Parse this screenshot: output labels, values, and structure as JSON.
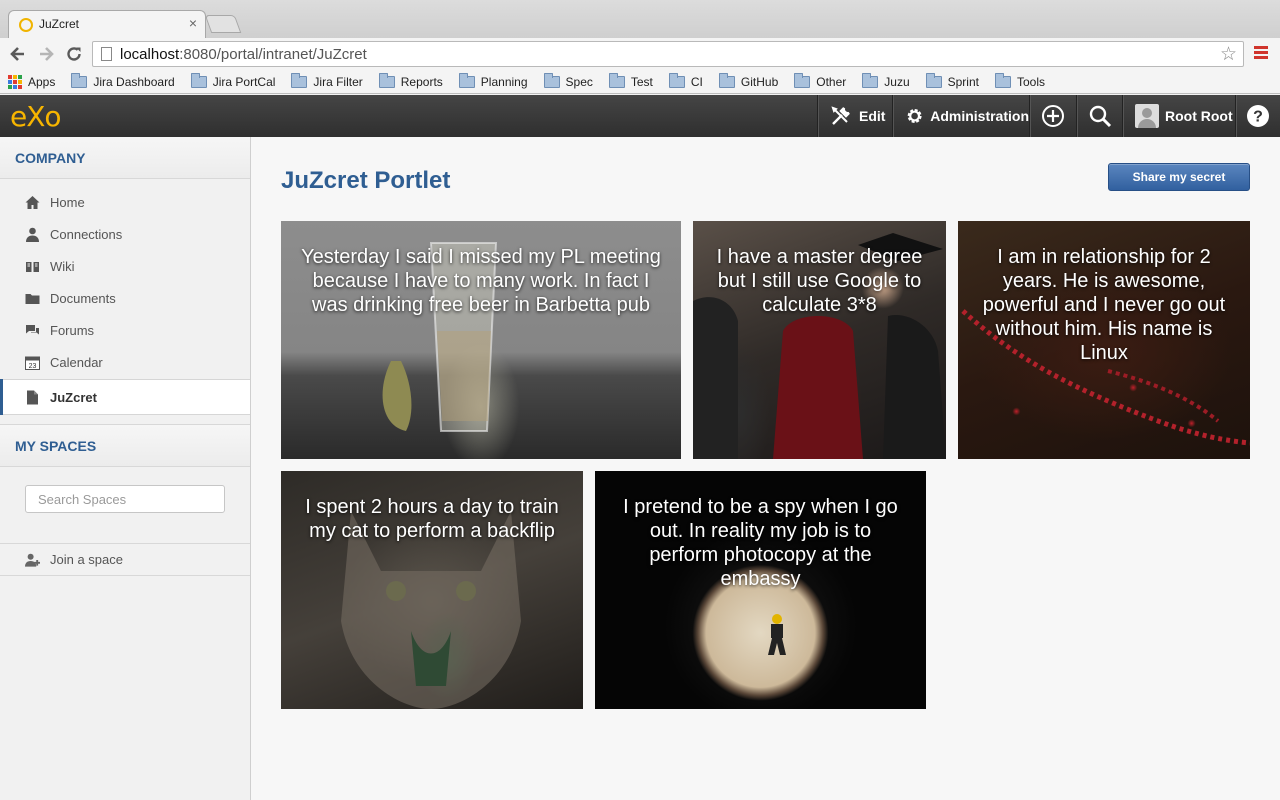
{
  "browser": {
    "tab_title": "JuZcret",
    "tab_close": "×",
    "url_host": "localhost",
    "url_rest": ":8080/portal/intranet/JuZcret",
    "back_icon": "arrow-left-icon",
    "forward_icon": "arrow-right-icon",
    "reload_icon": "reload-icon",
    "star_glyph": "☆",
    "bookmarks": [
      {
        "label": "Apps",
        "icon": "apps-grid-icon"
      },
      {
        "label": "Jira Dashboard",
        "icon": "folder-icon"
      },
      {
        "label": "Jira PortCal",
        "icon": "folder-icon"
      },
      {
        "label": "Jira Filter",
        "icon": "folder-icon"
      },
      {
        "label": "Reports",
        "icon": "folder-icon"
      },
      {
        "label": "Planning",
        "icon": "folder-icon"
      },
      {
        "label": "Spec",
        "icon": "folder-icon"
      },
      {
        "label": "Test",
        "icon": "folder-icon"
      },
      {
        "label": "CI",
        "icon": "folder-icon"
      },
      {
        "label": "GitHub",
        "icon": "folder-icon"
      },
      {
        "label": "Other",
        "icon": "folder-icon"
      },
      {
        "label": "Juzu",
        "icon": "folder-icon"
      },
      {
        "label": "Sprint",
        "icon": "folder-icon"
      },
      {
        "label": "Tools",
        "icon": "folder-icon"
      }
    ]
  },
  "topnav": {
    "logo": "eXo",
    "edit_label": "Edit",
    "administration_label": "Administration",
    "user_name": "Root Root",
    "help_glyph": "?"
  },
  "sidebar": {
    "company_title": "COMPANY",
    "items": [
      {
        "label": "Home",
        "icon": "home-icon"
      },
      {
        "label": "Connections",
        "icon": "person-icon"
      },
      {
        "label": "Wiki",
        "icon": "book-icon"
      },
      {
        "label": "Documents",
        "icon": "folder-icon"
      },
      {
        "label": "Forums",
        "icon": "chat-icon"
      },
      {
        "label": "Calendar",
        "icon": "calendar-icon"
      },
      {
        "label": "JuZcret",
        "icon": "document-icon",
        "active": true
      }
    ],
    "calendar_day": "23",
    "spaces_title": "MY SPACES",
    "search_placeholder": "Search Spaces",
    "join_label": "Join a space"
  },
  "main": {
    "title": "JuZcret Portlet",
    "share_button": "Share my secret",
    "secrets": [
      "Yesterday I said I missed my PL meeting because I have to many work. In fact I was drinking free beer in Barbetta pub",
      "I have a master degree but I still use Google to calculate 3*8",
      "I am in relationship for 2 years. He is awesome, powerful and I never go out without him. His name is Linux",
      "I spent 2 hours a day to train my cat to perform a backflip",
      "I pretend to be a spy when I go out. In reality my job is to perform photocopy at the embassy"
    ]
  },
  "colors": {
    "brand_blue": "#2f5e92",
    "logo_orange": "#f7b500",
    "menu_red": "#d0342c"
  }
}
